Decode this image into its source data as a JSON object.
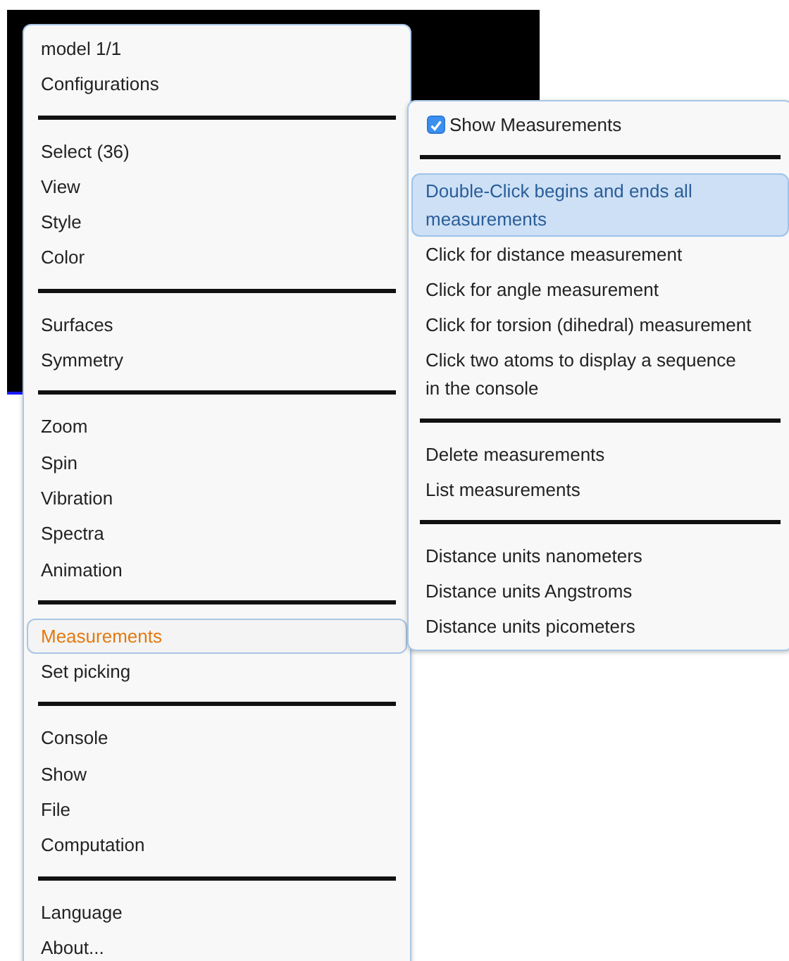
{
  "main_menu": [
    {
      "kind": "item",
      "label": "model 1/1",
      "open": false
    },
    {
      "kind": "item",
      "label": "Configurations",
      "open": false
    },
    {
      "kind": "separator"
    },
    {
      "kind": "item",
      "label": "Select (36)",
      "open": false
    },
    {
      "kind": "item",
      "label": "View",
      "open": false
    },
    {
      "kind": "item",
      "label": "Style",
      "open": false
    },
    {
      "kind": "item",
      "label": "Color",
      "open": false
    },
    {
      "kind": "separator"
    },
    {
      "kind": "item",
      "label": "Surfaces",
      "open": false
    },
    {
      "kind": "item",
      "label": "Symmetry",
      "open": false
    },
    {
      "kind": "separator"
    },
    {
      "kind": "item",
      "label": "Zoom",
      "open": false
    },
    {
      "kind": "item",
      "label": "Spin",
      "open": false
    },
    {
      "kind": "item",
      "label": "Vibration",
      "open": false
    },
    {
      "kind": "item",
      "label": "Spectra",
      "open": false
    },
    {
      "kind": "item",
      "label": "Animation",
      "open": false
    },
    {
      "kind": "separator"
    },
    {
      "kind": "item",
      "label": "Measurements",
      "open": true
    },
    {
      "kind": "item",
      "label": "Set picking",
      "open": false
    },
    {
      "kind": "separator"
    },
    {
      "kind": "item",
      "label": "Console",
      "open": false
    },
    {
      "kind": "item",
      "label": "Show",
      "open": false
    },
    {
      "kind": "item",
      "label": "File",
      "open": false
    },
    {
      "kind": "item",
      "label": "Computation",
      "open": false
    },
    {
      "kind": "separator"
    },
    {
      "kind": "item",
      "label": "Language",
      "open": false
    },
    {
      "kind": "item",
      "label": "About...",
      "open": false
    }
  ],
  "submenu": [
    {
      "kind": "checkbox",
      "label": "Show Measurements",
      "checked": true,
      "hovered": false
    },
    {
      "kind": "separator"
    },
    {
      "kind": "item",
      "label": "Double-Click begins and ends all measurements",
      "hovered": true
    },
    {
      "kind": "item",
      "label": "Click for distance measurement",
      "hovered": false
    },
    {
      "kind": "item",
      "label": "Click for angle measurement",
      "hovered": false
    },
    {
      "kind": "item",
      "label": "Click for torsion (dihedral) measurement",
      "hovered": false
    },
    {
      "kind": "item",
      "label": "Click two atoms to display a sequence in the console",
      "hovered": false
    },
    {
      "kind": "separator"
    },
    {
      "kind": "item",
      "label": "Delete measurements",
      "hovered": false
    },
    {
      "kind": "item",
      "label": "List measurements",
      "hovered": false
    },
    {
      "kind": "separator"
    },
    {
      "kind": "item",
      "label": "Distance units nanometers",
      "hovered": false
    },
    {
      "kind": "item",
      "label": "Distance units Angstroms",
      "hovered": false
    },
    {
      "kind": "item",
      "label": "Distance units picometers",
      "hovered": false
    }
  ]
}
